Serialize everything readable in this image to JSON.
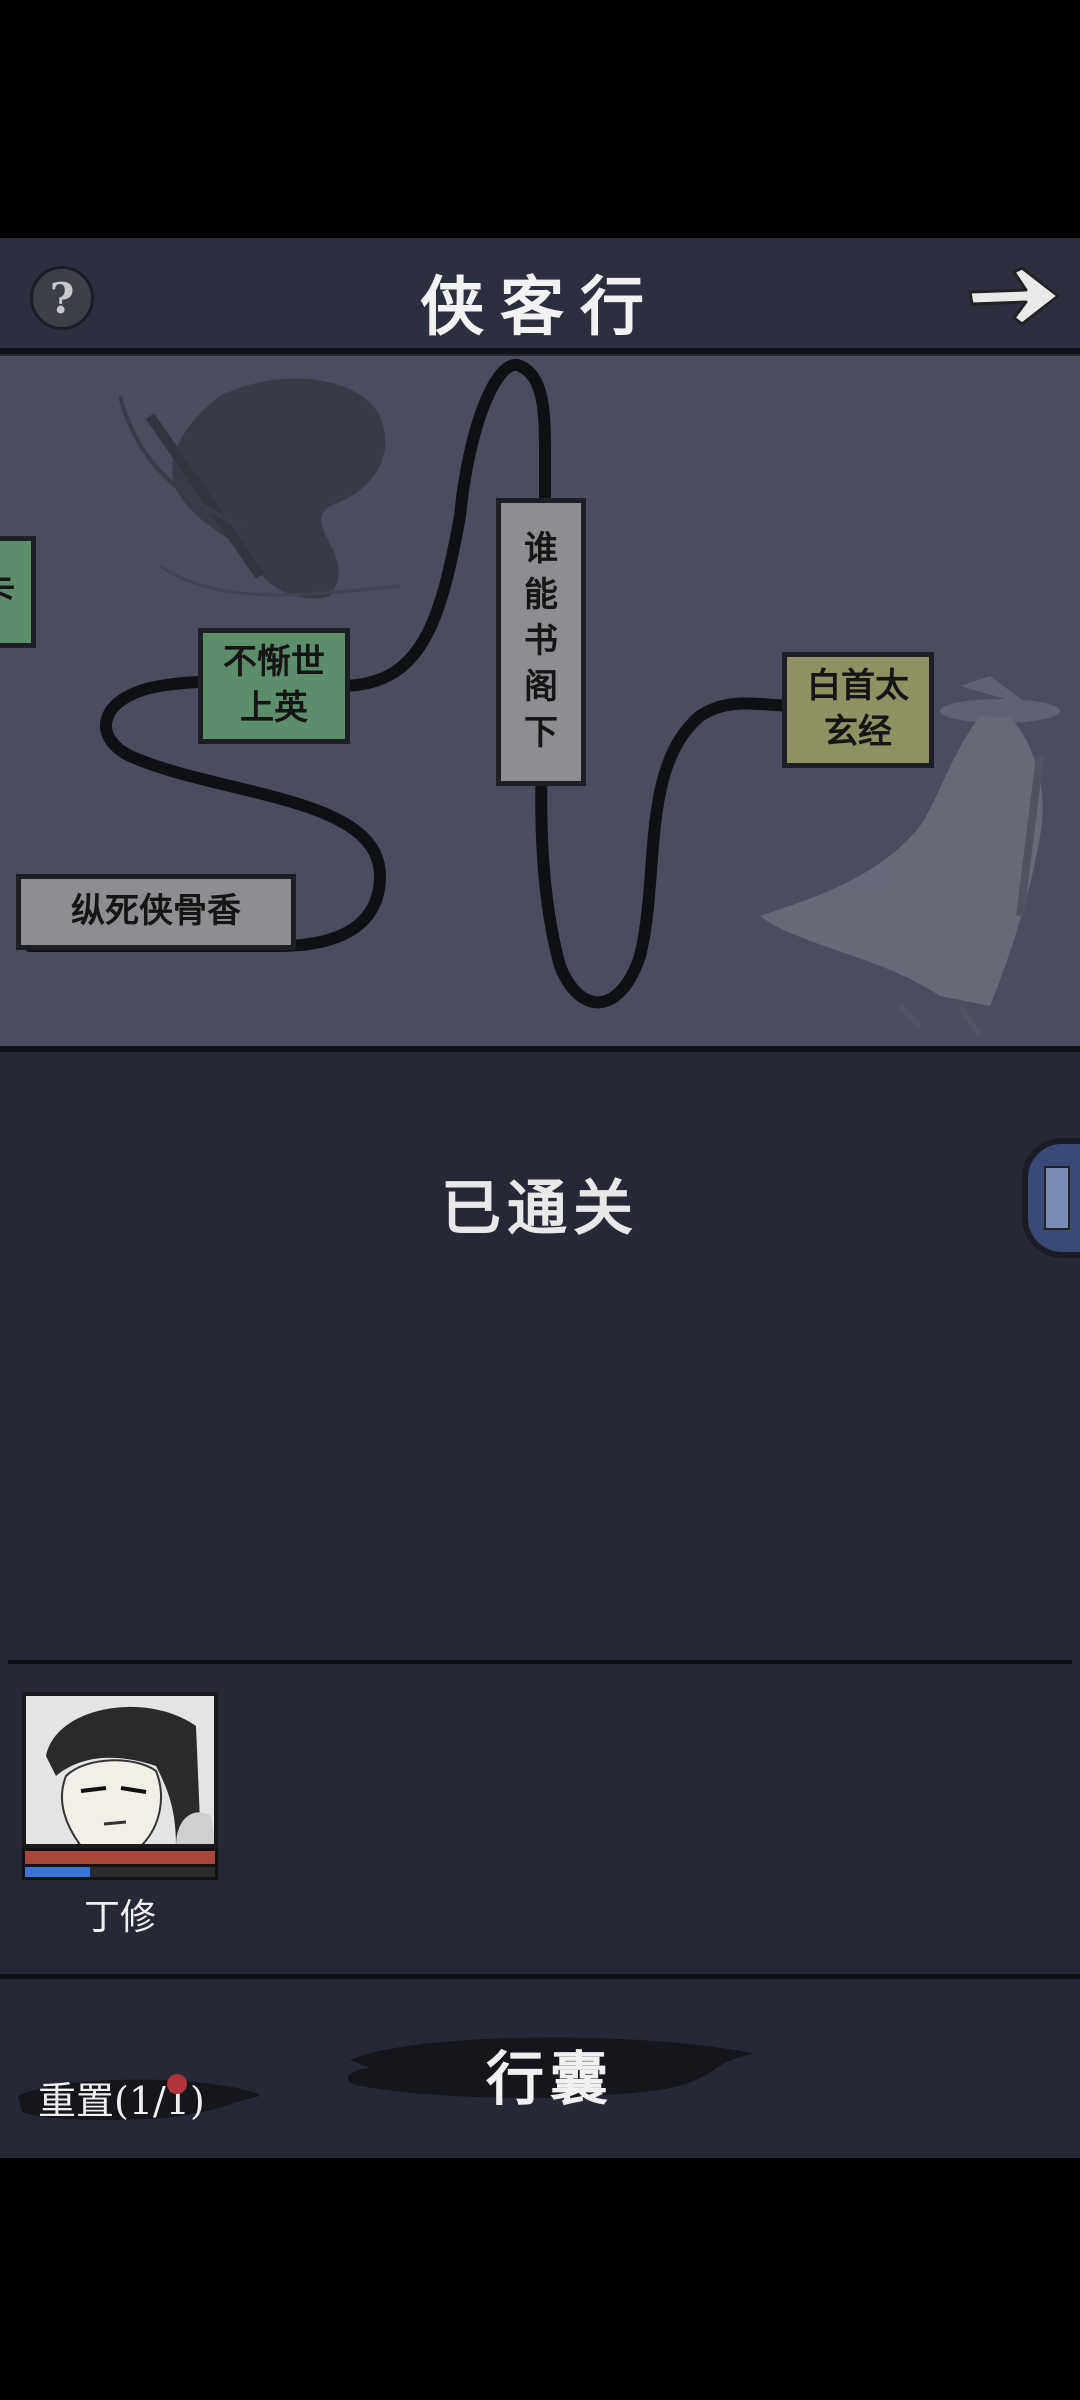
{
  "header": {
    "title": "侠客行",
    "help_icon": "question-mark-icon",
    "next_icon": "arrow-right-icon"
  },
  "map": {
    "nodes": [
      {
        "id": "partial-left",
        "label": "卡",
        "color": "#5c8e6c"
      },
      {
        "id": "bu-cheng",
        "label": "不惭世\n上英",
        "color": "#5c8e6c"
      },
      {
        "id": "shui-neng",
        "label": "谁\n能\n书\n阁\n下",
        "color": "#8d8e92"
      },
      {
        "id": "bai-shou",
        "label": "白首太\n玄经",
        "color": "#8f9162"
      },
      {
        "id": "zong-si",
        "label": "纵死侠骨香",
        "color": "#8d8e92"
      }
    ]
  },
  "status": "已通关",
  "character": {
    "name": "丁修",
    "hp_fraction": 1.0,
    "mp_fraction": 0.34
  },
  "bottom": {
    "bag_label": "行囊",
    "reset_label": "重置(1/1)"
  },
  "colors": {
    "background": "#262836",
    "map_background": "#4a4d5d",
    "hp": "#a7483a",
    "mp": "#3c74d6",
    "notification_dot": "#b0343a"
  }
}
